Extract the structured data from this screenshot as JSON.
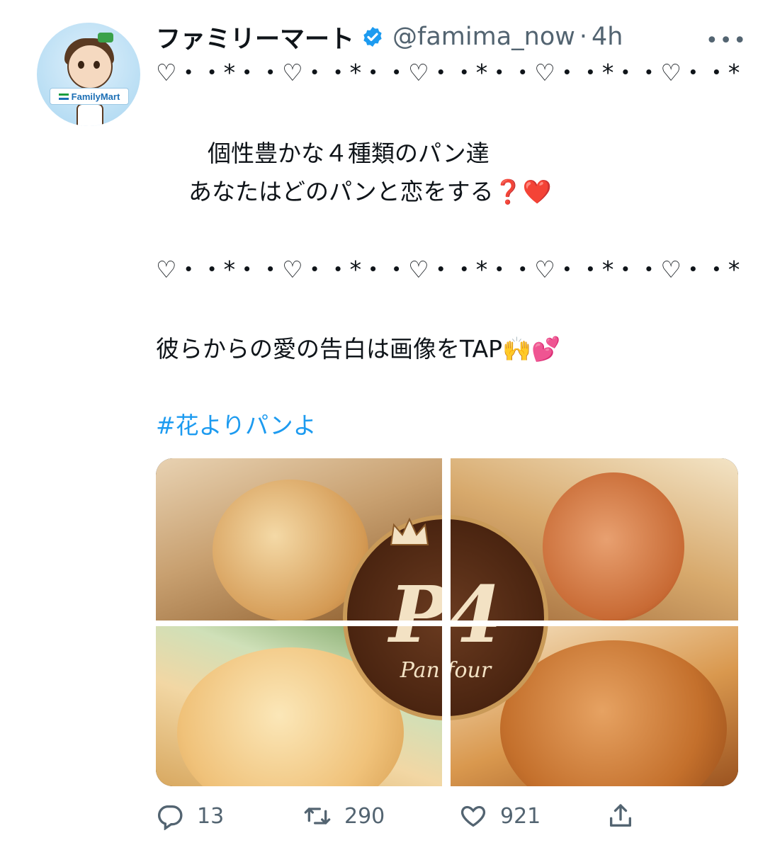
{
  "author": {
    "display_name": "ファミリーマート",
    "handle": "@famima_now",
    "separator": "·",
    "time": "4h",
    "avatar_badge": "FamilyMart",
    "verified": true
  },
  "menu": {
    "more_label": "•••"
  },
  "tweet": {
    "lines": [
      "♡・・*・・♡・・*・・♡・・*・・♡・・*・・♡・・*",
      "",
      "　個性豊かな４種類のパン達",
      "あなたはどのパンと恋をする❓❤️",
      "",
      "♡・・*・・♡・・*・・♡・・*・・♡・・*・・♡・・*",
      "",
      "彼らからの愛の告白は画像をTAP🙌💕",
      "",
      "#花よりパンよ"
    ],
    "hashtag": "#花よりパンよ"
  },
  "media": {
    "logo_text": "P4",
    "logo_subtext": "Pan four"
  },
  "actions": {
    "replies": "13",
    "retweets": "290",
    "likes": "921"
  },
  "colors": {
    "link": "#1d9bf0",
    "secondary_text": "#536471",
    "verified": "#1d9bf0"
  },
  "icons": [
    "reply-icon",
    "retweet-icon",
    "like-icon",
    "share-icon",
    "verified-icon",
    "more-icon"
  ]
}
